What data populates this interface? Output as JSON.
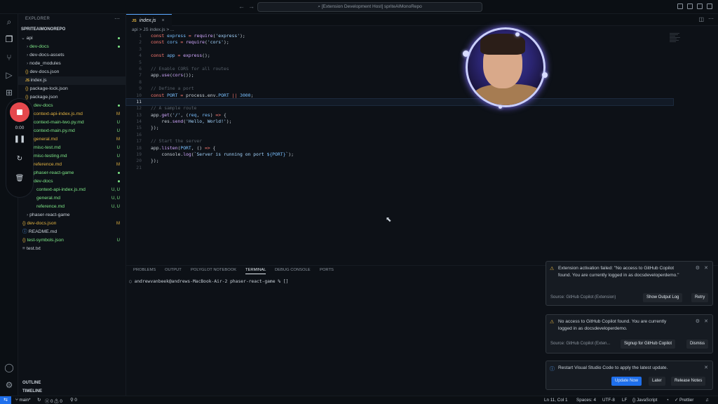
{
  "titlebar": {
    "command_center": "[Extension Development Host] spriteAIMonoRepo"
  },
  "sidebar": {
    "explorer_title": "EXPLORER",
    "repo_title": "SPRITEAIMONOREPO",
    "items": [
      {
        "label": "api",
        "status": ""
      },
      {
        "label": "dev-docs",
        "status": ""
      },
      {
        "label": "dev-docs-assets",
        "status": ""
      },
      {
        "label": "node_modules",
        "status": ""
      },
      {
        "label": "dev-docs.json",
        "status": ""
      },
      {
        "label": "index.js",
        "status": ""
      },
      {
        "label": "package-lock.json",
        "status": ""
      },
      {
        "label": "package.json",
        "status": ""
      },
      {
        "label": "dev-docs",
        "status": ""
      },
      {
        "label": "context-api-index.js.md",
        "status": "M"
      },
      {
        "label": "context-main-two.py.md",
        "status": "U"
      },
      {
        "label": "context-main.py.md",
        "status": "U"
      },
      {
        "label": "general.md",
        "status": "M"
      },
      {
        "label": "misc-test.md",
        "status": "U"
      },
      {
        "label": "misc-testing.md",
        "status": "U"
      },
      {
        "label": "reference.md",
        "status": "M"
      },
      {
        "label": "phaser-react-game",
        "status": ""
      },
      {
        "label": "dev-docs",
        "status": ""
      },
      {
        "label": "context-api-index.js.md",
        "status": "U, U"
      },
      {
        "label": "general.md",
        "status": "U, U"
      },
      {
        "label": "reference.md",
        "status": "U, U"
      },
      {
        "label": "phaser-react-game",
        "status": ""
      },
      {
        "label": "dev-docs.json",
        "status": "M"
      },
      {
        "label": "README.md",
        "status": ""
      },
      {
        "label": "test-symbols.json",
        "status": "U"
      },
      {
        "label": "test.txt",
        "status": ""
      }
    ],
    "outline": "OUTLINE",
    "timeline": "TIMELINE"
  },
  "recorder": {
    "time": "0:00"
  },
  "editor": {
    "tab_label": "index.js",
    "breadcrumb": "api > JS index.js > ...",
    "line_numbers": [
      "1",
      "2",
      "3",
      "4",
      "5",
      "6",
      "7",
      "8",
      "9",
      "10",
      "11",
      "12",
      "13",
      "14",
      "15",
      "16",
      "17",
      "18",
      "19",
      "20",
      "21"
    ],
    "active_line": 11
  },
  "panel": {
    "tabs": [
      "PROBLEMS",
      "OUTPUT",
      "POLYGLOT NOTEBOOK",
      "TERMINAL",
      "DEBUG CONSOLE",
      "PORTS"
    ],
    "active_tab": "TERMINAL",
    "terminal_prompt": "andrewvanbeek@andrews-MacBook-Air-2 phaser-react-game % []"
  },
  "notifications": [
    {
      "message_line1": "Extension activation failed: \"No access to GitHub Copilot",
      "message_line2": "found. You are currently logged in as docsdeveloperdemo.\"",
      "source": "Source: GitHub Copilot (Extension)",
      "buttons": [
        "Show Output Log",
        "Retry"
      ]
    },
    {
      "message_line1": "No access to GitHub Copilot found. You are currently",
      "message_line2": "logged in as docsdeveloperdemo.",
      "source": "Source: GitHub Copilot (Exten...",
      "buttons": [
        "Signup for GitHub Copilot",
        "Dismiss"
      ]
    },
    {
      "message_line1": "Restart Visual Studio Code to apply the latest update.",
      "message_line2": "",
      "source": "",
      "buttons": [
        "Update Now",
        "Later",
        "Release Notes"
      ]
    }
  ],
  "statusbar": {
    "branch": "main*",
    "errors": "0",
    "warnings": "0",
    "ports": "0",
    "position": "Ln 11, Col 1",
    "spaces": "Spaces: 4",
    "encoding": "UTF-8",
    "eol": "LF",
    "language": "JavaScript",
    "formatter": "Prettier"
  },
  "colors": {
    "accent": "#1f6feb",
    "record": "#e5484d",
    "warning": "#e3b341",
    "added": "#7ee787"
  }
}
